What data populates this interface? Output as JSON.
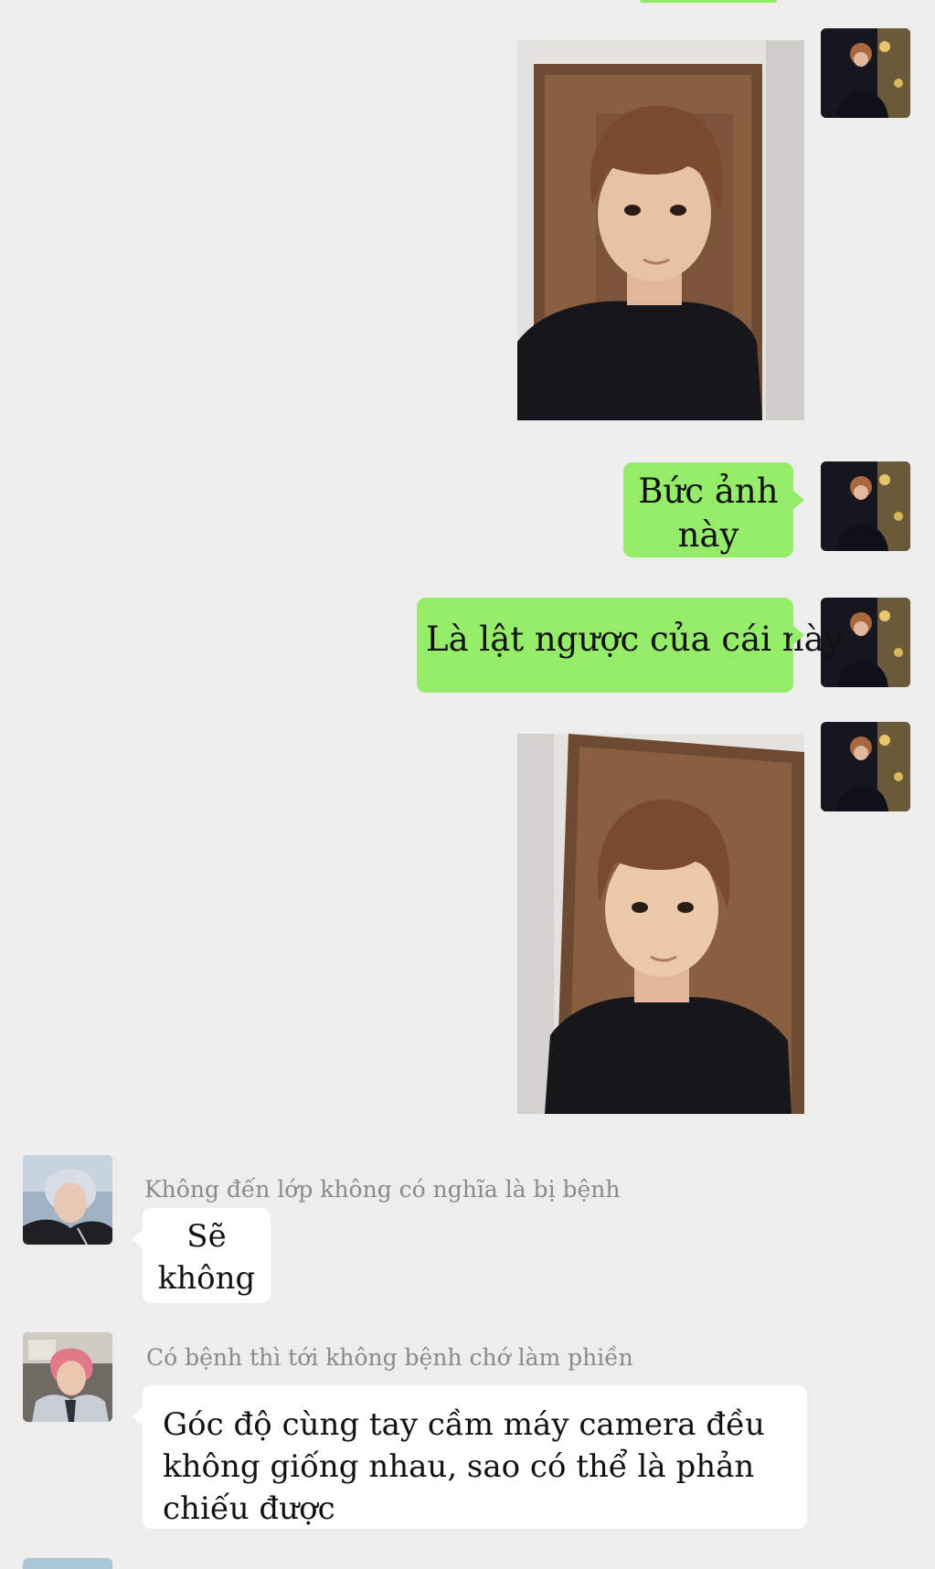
{
  "chat": {
    "messages": [
      {
        "id": "m1",
        "direction": "sent",
        "type": "image",
        "image": "selfie-photo-original"
      },
      {
        "id": "m2",
        "direction": "sent",
        "type": "text",
        "text": "Bức ảnh này"
      },
      {
        "id": "m3",
        "direction": "sent",
        "type": "text",
        "text": "Là lật ngược của cái này"
      },
      {
        "id": "m4",
        "direction": "sent",
        "type": "image",
        "image": "selfie-photo-flipped"
      },
      {
        "id": "m5",
        "direction": "received",
        "type": "text",
        "sender": "Không đến lớp không có nghĩa là bị bệnh",
        "text": "Sẽ không"
      },
      {
        "id": "m6",
        "direction": "received",
        "type": "text",
        "sender": "Có bệnh thì tới không bệnh chớ làm phiền",
        "text": "Góc độ cùng tay cầm máy camera đều không giống nhau, sao có thể là phản chiếu được"
      }
    ]
  },
  "colors": {
    "background": "#ededed",
    "sent_bubble": "#95ec69",
    "received_bubble": "#ffffff",
    "sender_name": "#8a8a8a"
  }
}
